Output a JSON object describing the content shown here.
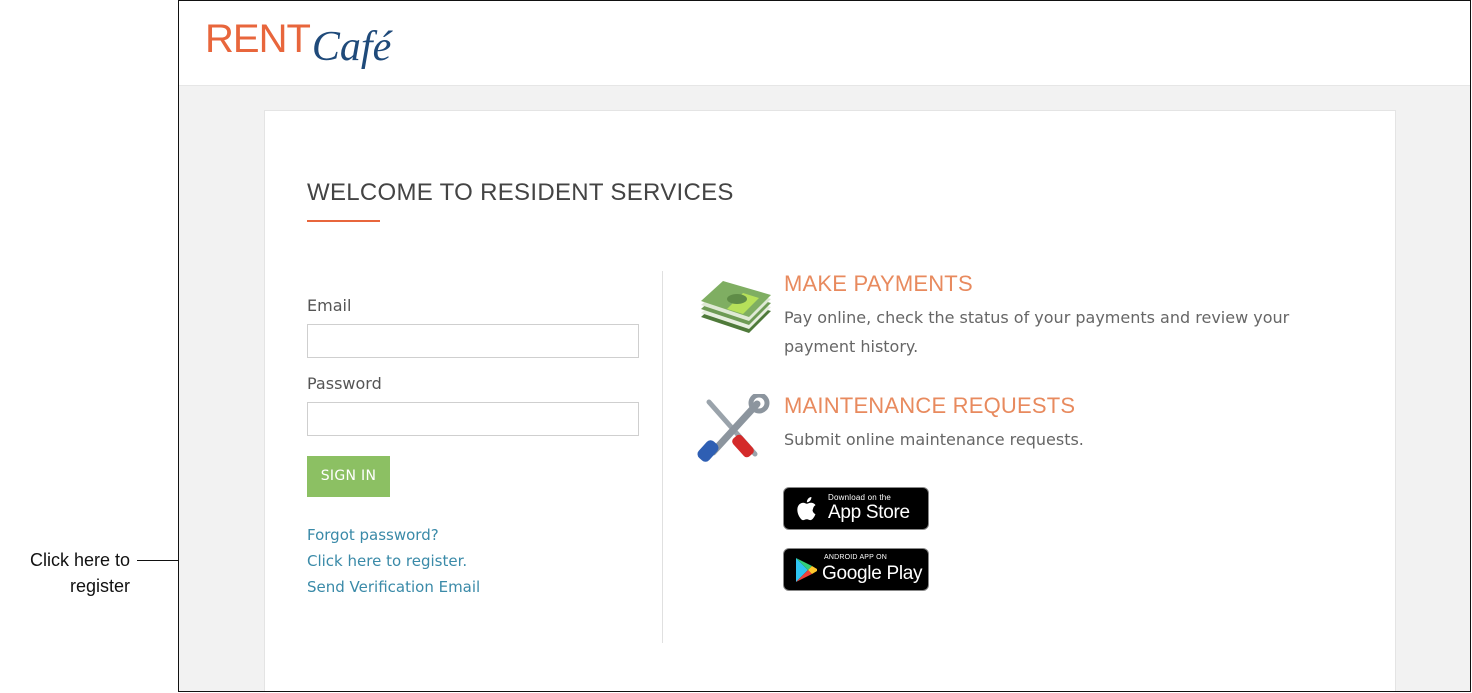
{
  "annotation": {
    "line1": "Click here to",
    "line2": "register"
  },
  "logo": {
    "rent": "RENT",
    "cafe": "Café"
  },
  "welcome_title": "WELCOME TO RESIDENT SERVICES",
  "form": {
    "email_label": "Email",
    "email_value": "",
    "password_label": "Password",
    "password_value": "",
    "signin_label": "SIGN IN"
  },
  "links": {
    "forgot": "Forgot password?",
    "register": "Click here to register.",
    "verify": "Send Verification Email"
  },
  "features": {
    "payments": {
      "title": "MAKE PAYMENTS",
      "desc_line1": "Pay online, check the status of your payments and review your",
      "desc_line2": "payment history.",
      "icon": "money-stack-icon"
    },
    "maintenance": {
      "title": "MAINTENANCE REQUESTS",
      "desc": "Submit online maintenance requests.",
      "icon": "tools-icon"
    }
  },
  "badges": {
    "appstore_small": "Download on the",
    "appstore_big": "App Store",
    "googleplay_small": "ANDROID APP ON",
    "googleplay_big": "Google Play"
  },
  "colors": {
    "brand_orange": "#e8663c",
    "brand_blue": "#1f4a7a",
    "signin_green": "#8cc063",
    "link_blue": "#3a8aa8"
  }
}
